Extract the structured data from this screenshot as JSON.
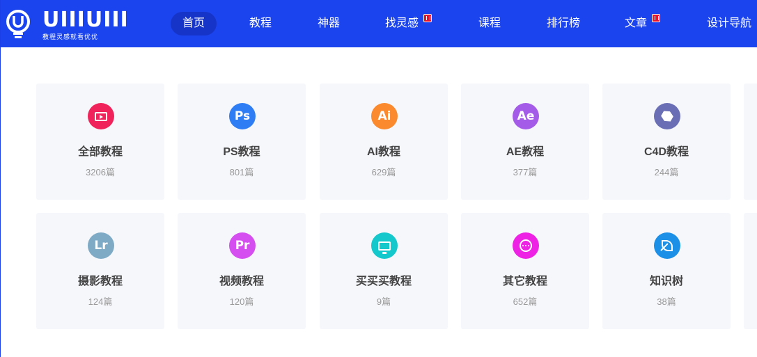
{
  "header": {
    "logo_text": "UIIIUIII",
    "slogan": "教程灵感就看优优",
    "nav": [
      {
        "label": "首页",
        "active": true,
        "hot": false
      },
      {
        "label": "教程",
        "active": false,
        "hot": false
      },
      {
        "label": "神器",
        "active": false,
        "hot": false
      },
      {
        "label": "找灵感",
        "active": false,
        "hot": true
      },
      {
        "label": "课程",
        "active": false,
        "hot": false
      },
      {
        "label": "排行榜",
        "active": false,
        "hot": false
      },
      {
        "label": "文章",
        "active": false,
        "hot": true
      },
      {
        "label": "设计导航",
        "active": false,
        "hot": false
      }
    ]
  },
  "categories": [
    {
      "title": "全部教程",
      "count": "3206篇",
      "icon": "video-icon",
      "icon_text": "",
      "color": "#f0245a"
    },
    {
      "title": "PS教程",
      "count": "801篇",
      "icon": "photoshop-icon",
      "icon_text": "Ps",
      "color": "#2f7df5"
    },
    {
      "title": "AI教程",
      "count": "629篇",
      "icon": "illustrator-icon",
      "icon_text": "Ai",
      "color": "#fb8a2e"
    },
    {
      "title": "AE教程",
      "count": "377篇",
      "icon": "after-effects-icon",
      "icon_text": "Ae",
      "color": "#a35be8"
    },
    {
      "title": "C4D教程",
      "count": "244篇",
      "icon": "cube-icon",
      "icon_text": "",
      "color": "#6a6fb5"
    },
    {
      "title": "摄影教程",
      "count": "124篇",
      "icon": "lightroom-icon",
      "icon_text": "Lr",
      "color": "#7eaac6"
    },
    {
      "title": "视频教程",
      "count": "120篇",
      "icon": "premiere-icon",
      "icon_text": "Pr",
      "color": "#d44ef0"
    },
    {
      "title": "买买买教程",
      "count": "9篇",
      "icon": "monitor-icon",
      "icon_text": "",
      "color": "#15c8cc"
    },
    {
      "title": "其它教程",
      "count": "652篇",
      "icon": "more-dots-icon",
      "icon_text": "",
      "color": "#ee22e4"
    },
    {
      "title": "知识树",
      "count": "38篇",
      "icon": "leaf-icon",
      "icon_text": "",
      "color": "#1c8fe6"
    }
  ]
}
